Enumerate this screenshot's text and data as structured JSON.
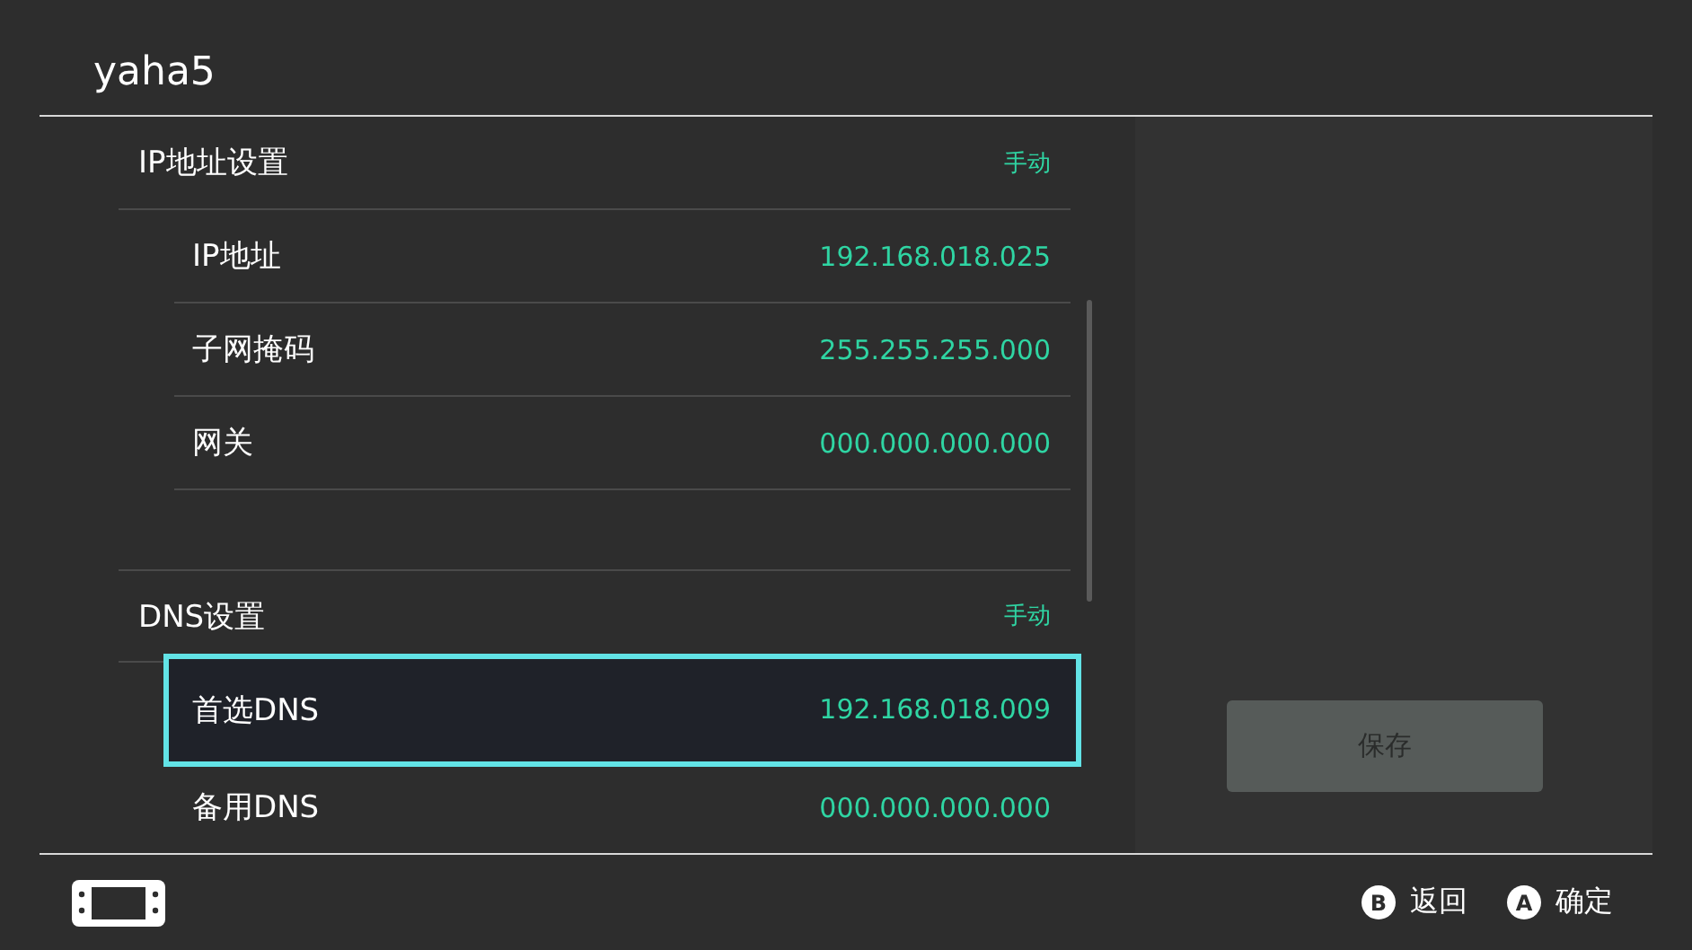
{
  "window": {
    "title": "yaha5"
  },
  "sections": [
    {
      "label": "IP地址设置",
      "value": "手动",
      "items": [
        {
          "label": "IP地址",
          "value": "192.168.018.025",
          "selected": false
        },
        {
          "label": "子网掩码",
          "value": "255.255.255.000",
          "selected": false
        },
        {
          "label": "网关",
          "value": "000.000.000.000",
          "selected": false
        }
      ]
    },
    {
      "label": "DNS设置",
      "value": "手动",
      "items": [
        {
          "label": "首选DNS",
          "value": "192.168.018.009",
          "selected": true
        },
        {
          "label": "备用DNS",
          "value": "000.000.000.000",
          "selected": false
        }
      ]
    }
  ],
  "save_button": {
    "label": "保存",
    "disabled": true
  },
  "footer": {
    "hints": [
      {
        "key": "B",
        "label": "返回"
      },
      {
        "key": "A",
        "label": "确定"
      }
    ]
  }
}
